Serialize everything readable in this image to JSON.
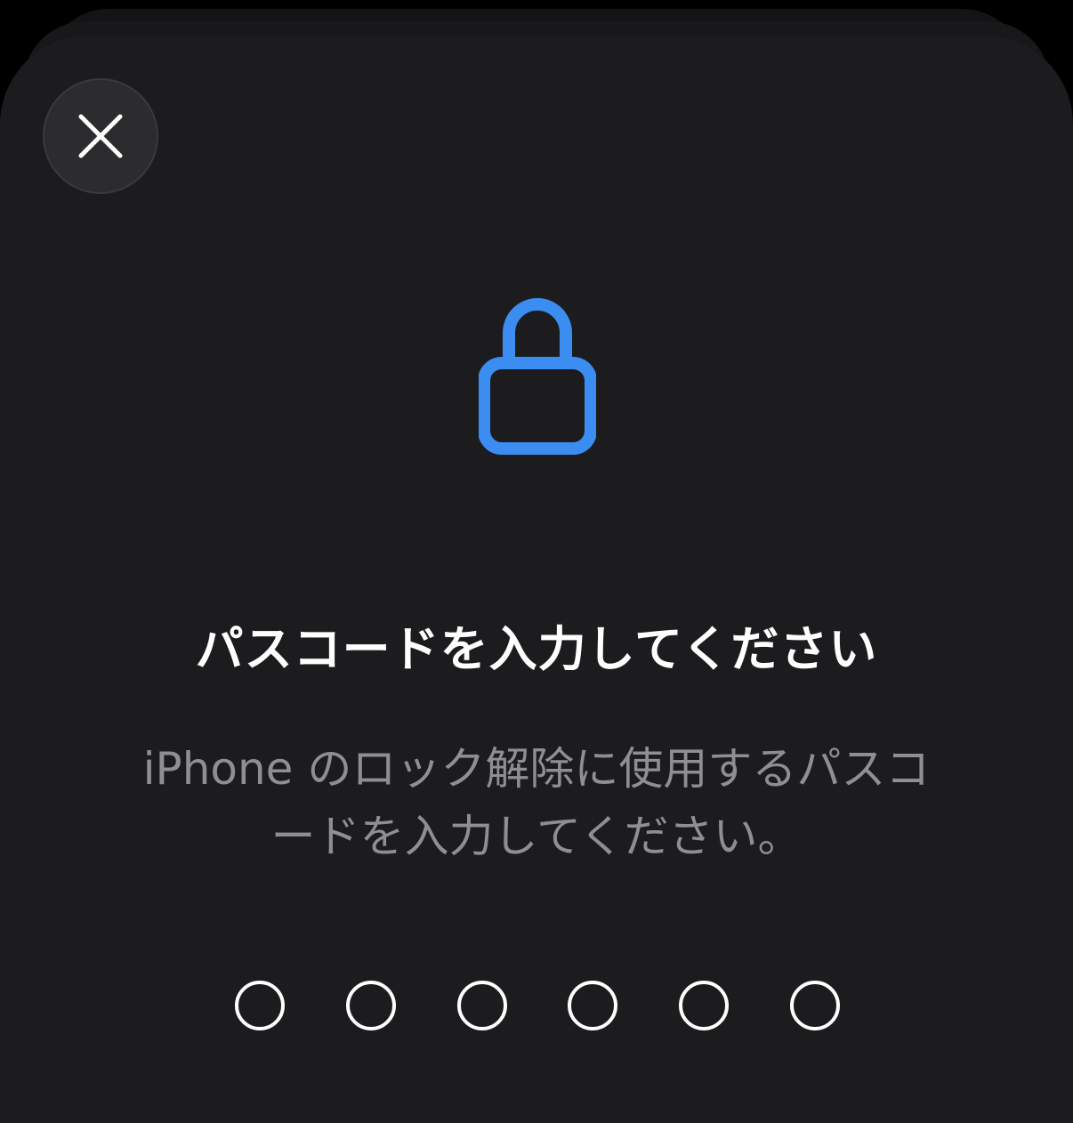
{
  "screen": {
    "title": "パスコードを入力してください",
    "subtitle": "iPhone のロック解除に使用するパスコードを入力してください。",
    "accent_color": "#3b8df2"
  },
  "close_button": {
    "icon": "close-icon"
  },
  "lock": {
    "icon": "lock-icon"
  },
  "passcode": {
    "length": 6,
    "entered": 0
  }
}
